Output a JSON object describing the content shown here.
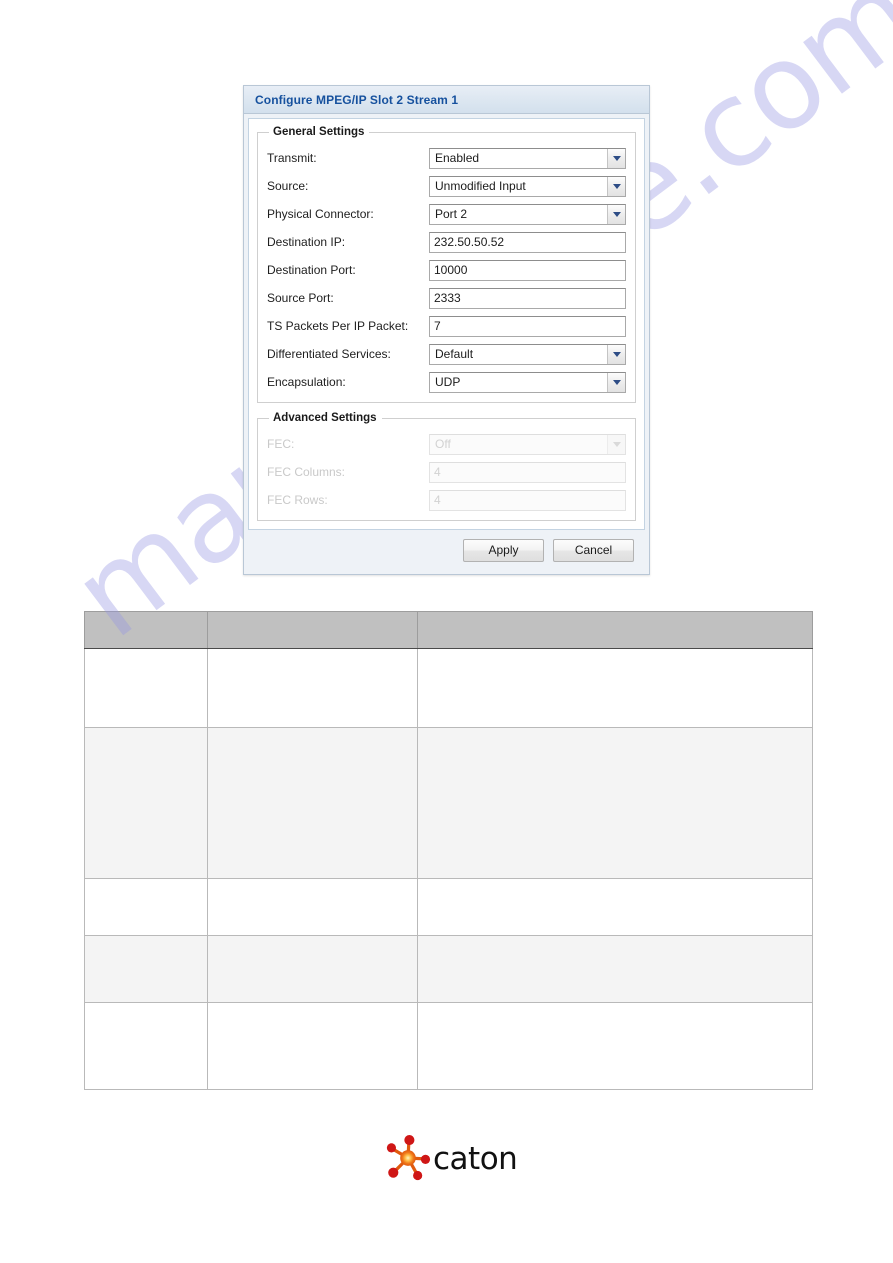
{
  "dialog": {
    "title": "Configure MPEG/IP Slot 2 Stream 1",
    "general_group": {
      "legend": "General Settings",
      "fields": [
        {
          "label": "Transmit:",
          "value": "Enabled",
          "type": "select"
        },
        {
          "label": "Source:",
          "value": "Unmodified Input",
          "type": "select"
        },
        {
          "label": "Physical Connector:",
          "value": "Port 2",
          "type": "select"
        },
        {
          "label": "Destination IP:",
          "value": "232.50.50.52",
          "type": "text"
        },
        {
          "label": "Destination Port:",
          "value": "10000",
          "type": "text"
        },
        {
          "label": "Source Port:",
          "value": "2333",
          "type": "text"
        },
        {
          "label": "TS Packets Per IP Packet:",
          "value": "7",
          "type": "text"
        },
        {
          "label": "Differentiated Services:",
          "value": "Default",
          "type": "select"
        },
        {
          "label": "Encapsulation:",
          "value": "UDP",
          "type": "select"
        }
      ]
    },
    "advanced_group": {
      "legend": "Advanced Settings",
      "disabled": true,
      "fields": [
        {
          "label": "FEC:",
          "value": "Off",
          "type": "select"
        },
        {
          "label": "FEC Columns:",
          "value": "4",
          "type": "text"
        },
        {
          "label": "FEC Rows:",
          "value": "4",
          "type": "text"
        }
      ]
    },
    "buttons": {
      "apply": "Apply",
      "cancel": "Cancel"
    },
    "colors": {
      "title_text": "#16519e",
      "chevron": "#2e4d86",
      "titlebar_bg": "#dde7f1"
    }
  },
  "table": {
    "columns": [
      "",
      "",
      ""
    ],
    "rows": [
      [
        "",
        "",
        ""
      ],
      [
        "",
        "",
        ""
      ],
      [
        "",
        "",
        ""
      ],
      [
        "",
        "",
        ""
      ],
      [
        "",
        "",
        ""
      ]
    ]
  },
  "logo": {
    "text": "caton",
    "mark_colors": [
      "#f07818",
      "#d41b1b",
      "#fdd017"
    ]
  },
  "watermark": {
    "text": "manualshive.com",
    "color": "#9696e1"
  }
}
